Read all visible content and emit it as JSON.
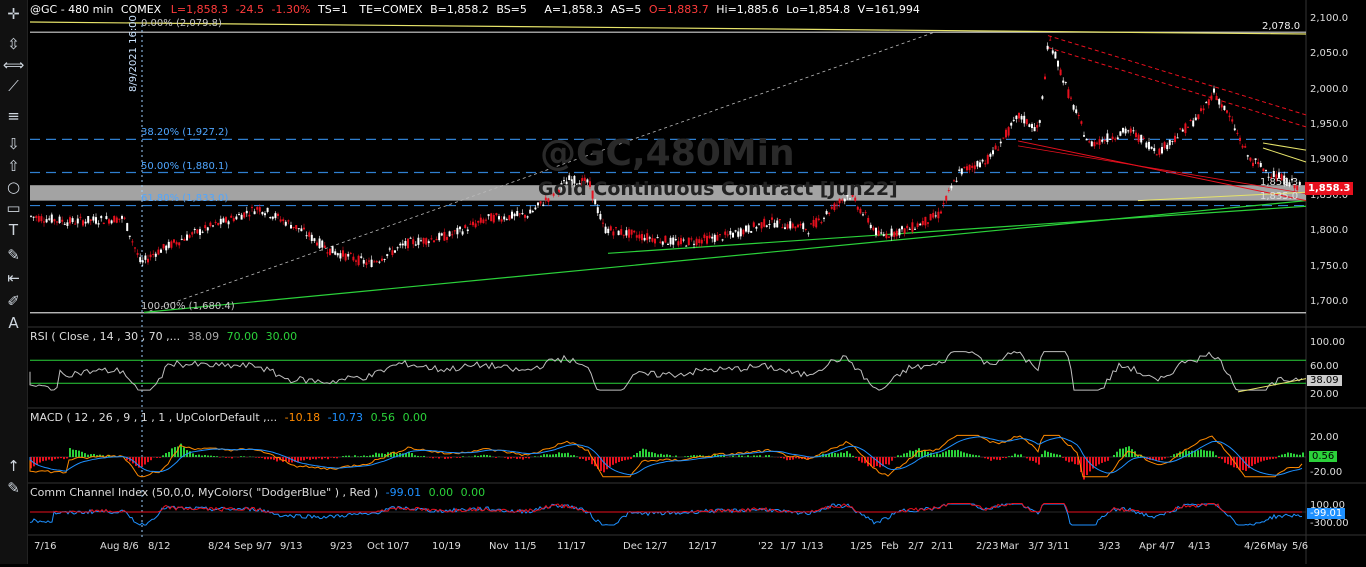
{
  "header": {
    "symbol": "@GC - 480 min",
    "exchange": "COMEX",
    "last": "L=1,858.3",
    "change": "-24.5",
    "change_pct": "-1.30%",
    "ts": "TS=1",
    "te": "TE=COMEX",
    "bid": "B=1,858.2",
    "bid_size": "BS=5",
    "ask": "A=1,858.3",
    "ask_size": "AS=5",
    "open": "O=1,883.7",
    "high": "Hi=1,885.6",
    "low": "Lo=1,854.8",
    "volume": "V=161,994"
  },
  "watermark": {
    "line1": "@GC,480Min",
    "line2": "Gold Continuous Contract [Jun22]"
  },
  "date_marker": "8/9/2021 16:00",
  "fib_labels": {
    "f0": "0.00% (2,079.8)",
    "f382": "38.20% (1,927.2)",
    "f50": "50.00% (1,880.1)",
    "f618": "61.80% (1,833.0)",
    "f100": "100.00% (1,680.4)"
  },
  "price_axis": {
    "ticks": [
      "2,100.0",
      "2,050.0",
      "2,000.0",
      "1,950.0",
      "1,900.0",
      "1,850.0",
      "1,800.0",
      "1,750.0",
      "1,700.0"
    ]
  },
  "price_labels": {
    "top_line": "2,078.0",
    "last_price": "1,858.3",
    "small1": "1,859.3",
    "small2": "1,835.0"
  },
  "rsi": {
    "title": "RSI ( Close , 14 , 30 , 70 ,...",
    "v1": "38.09",
    "v2": "70.00",
    "v3": "30.00",
    "axis": [
      "100.00",
      "60.00",
      "20.00"
    ],
    "current": "38.09"
  },
  "macd": {
    "title": "MACD ( 12 , 26 , 9 , 1 , 1 , UpColorDefault ,...",
    "v1": "-10.18",
    "v2": "-10.73",
    "v3": "0.56",
    "v4": "0.00",
    "axis": [
      "20.00",
      "-20.00"
    ],
    "current": "0.56"
  },
  "cci": {
    "title": "Comm Channel Index (50,0,0, MyColors( \"DodgerBlue\" ) , Red )",
    "v1": "-99.01",
    "v2": "0.00",
    "v3": "0.00",
    "axis": [
      "100.00",
      "-300.00"
    ],
    "current": "-99.01"
  },
  "time_axis": [
    "7/16",
    "Aug 8/6",
    "8/12",
    "8/24",
    "Sep",
    "9/7",
    "9/13",
    "9/23",
    "Oct",
    "10/7",
    "10/19",
    "Nov",
    "11/5",
    "11/17",
    "Dec",
    "12/7",
    "12/17",
    "'22",
    "1/7",
    "1/13",
    "1/25",
    "Feb",
    "2/7",
    "2/11",
    "2/23",
    "Mar",
    "3/7",
    "3/11",
    "3/23",
    "Apr",
    "4/7",
    "4/13",
    "4/26",
    "May",
    "5/6"
  ],
  "colors": {
    "up": "#ffffff",
    "down": "#e8101e",
    "fib": "#2f7fd0",
    "green": "#2bd13a",
    "yellow": "#e6e36a",
    "orange": "#ff8a00",
    "blue": "#1e90ff"
  },
  "tools": [
    "crosshair-icon",
    "vertical-line-icon",
    "horizontal-arrows-icon",
    "pencil-line-icon",
    "horizontal-lines-icon",
    "arrow-down-icon",
    "arrow-up-icon",
    "circle-icon",
    "rectangle-icon",
    "text-tool-icon",
    "pencil-eraser-icon",
    "left-arrow-bar-icon",
    "pen-icon",
    "font-a-icon"
  ]
}
